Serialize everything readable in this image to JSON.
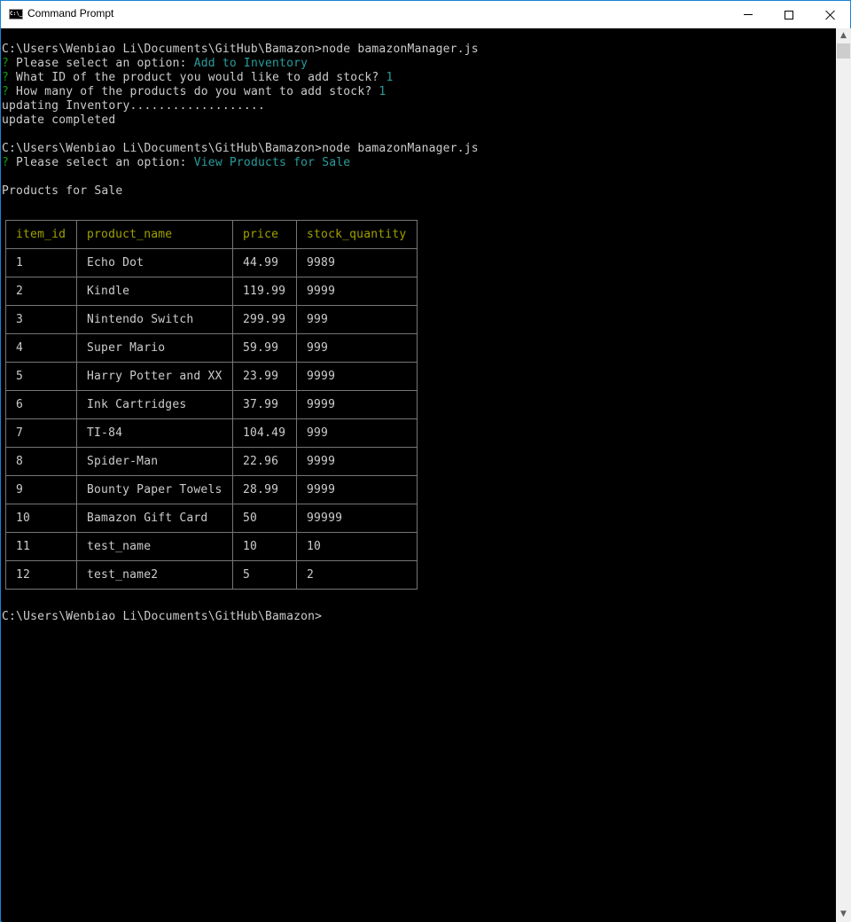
{
  "window": {
    "title": "Command Prompt",
    "icon": "cmd-icon",
    "controls": {
      "minimize": "minimize-icon",
      "maximize": "maximize-icon",
      "close": "close-icon"
    }
  },
  "colors": {
    "background": "#000000",
    "text": "#cccccc",
    "question_mark": "#13a10e",
    "answer": "#2a9d9d",
    "table_header": "#a0a000",
    "table_border": "#767676",
    "window_border": "#1883d7"
  },
  "console": {
    "session1": {
      "command": "C:\\Users\\Wenbiao Li\\Documents\\GitHub\\Bamazon>node bamazonManager.js",
      "prompts": [
        {
          "mark": "?",
          "question": " Please select an option: ",
          "answer": "Add to Inventory"
        },
        {
          "mark": "?",
          "question": " What ID of the product you would like to add stock? ",
          "answer": "1"
        },
        {
          "mark": "?",
          "question": " How many of the products do you want to add stock? ",
          "answer": "1"
        }
      ],
      "output": [
        "updating Inventory...................",
        "update completed"
      ]
    },
    "session2": {
      "command": "C:\\Users\\Wenbiao Li\\Documents\\GitHub\\Bamazon>node bamazonManager.js",
      "prompts": [
        {
          "mark": "?",
          "question": " Please select an option: ",
          "answer": "View Products for Sale"
        }
      ],
      "output": [
        "Products for Sale"
      ]
    },
    "final_prompt": "C:\\Users\\Wenbiao Li\\Documents\\GitHub\\Bamazon>"
  },
  "table": {
    "columns": [
      "item_id",
      "product_name",
      "price",
      "stock_quantity"
    ],
    "rows": [
      [
        "1",
        "Echo Dot",
        "44.99",
        "9989"
      ],
      [
        "2",
        "Kindle",
        "119.99",
        "9999"
      ],
      [
        "3",
        "Nintendo Switch",
        "299.99",
        "999"
      ],
      [
        "4",
        "Super Mario",
        "59.99",
        "999"
      ],
      [
        "5",
        "Harry Potter and XX",
        "23.99",
        "9999"
      ],
      [
        "6",
        "Ink Cartridges",
        "37.99",
        "9999"
      ],
      [
        "7",
        "TI-84",
        "104.49",
        "999"
      ],
      [
        "8",
        "Spider-Man",
        "22.96",
        "9999"
      ],
      [
        "9",
        "Bounty Paper Towels",
        "28.99",
        "9999"
      ],
      [
        "10",
        "Bamazon Gift Card",
        "50",
        "99999"
      ],
      [
        "11",
        "test_name",
        "10",
        "10"
      ],
      [
        "12",
        "test_name2",
        "5",
        "2"
      ]
    ]
  },
  "scrollbar": {
    "up": "chevron-up-icon",
    "down": "chevron-down-icon"
  }
}
